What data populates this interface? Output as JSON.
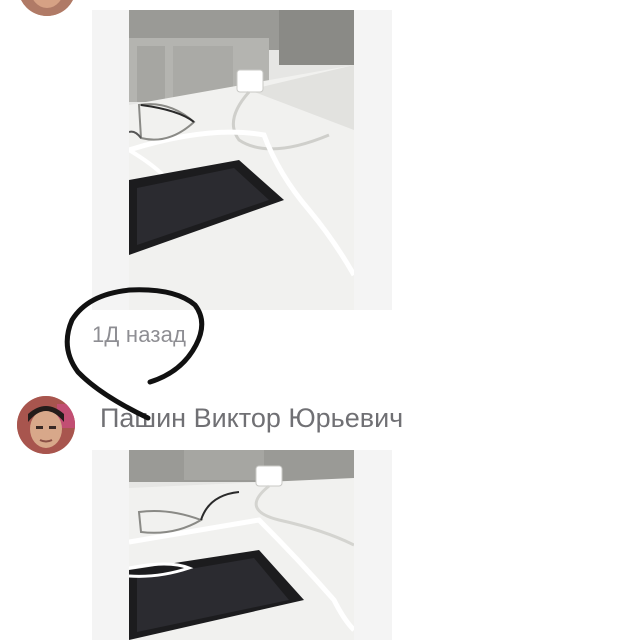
{
  "posts": [
    {
      "avatar_icon": "user-avatar",
      "photo_icon": "desk-photo-glasses-phone-charger",
      "timestamp": "1Д назад"
    },
    {
      "avatar_icon": "user-avatar",
      "author": "Пашин Виктор Юрьевич",
      "photo_icon": "desk-photo-glasses-phone-charger"
    }
  ],
  "annotation": {
    "icon": "hand-drawn-circle-stroke",
    "color": "#111111"
  },
  "colors": {
    "timestamp": "#8e8e93",
    "author": "#707074",
    "photo_frame": "#f4f4f4"
  }
}
